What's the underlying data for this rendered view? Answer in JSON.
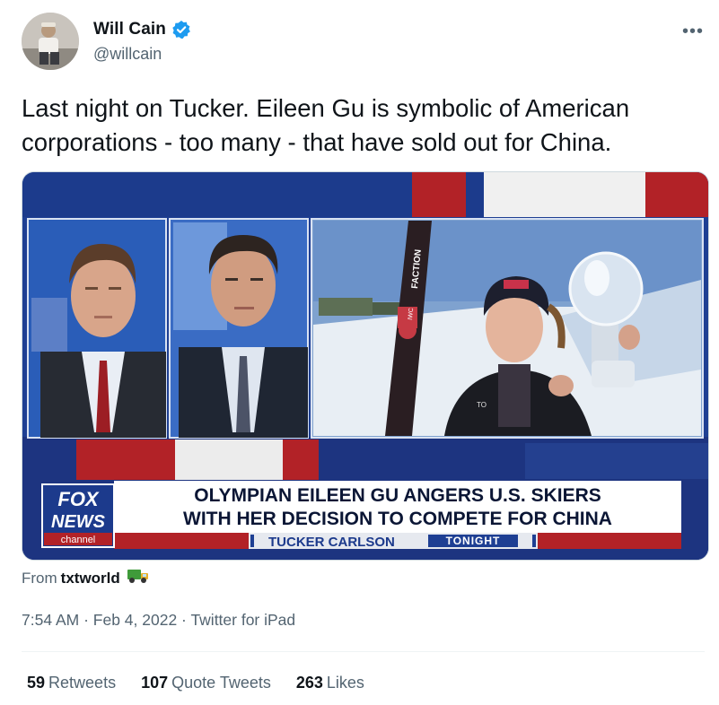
{
  "author": {
    "display_name": "Will Cain",
    "handle": "@willcain",
    "verified": true,
    "verified_color": "#1d9bf0"
  },
  "tweet": {
    "text": "Last night on Tucker. Eileen Gu is symbolic of American corporations - too many - that have sold out for China."
  },
  "media": {
    "chyron_line1": "OLYMPIAN EILEEN GU ANGERS U.S. SKIERS",
    "chyron_line2": "WITH HER DECISION TO COMPETE FOR CHINA",
    "show_name": "TUCKER CARLSON",
    "show_suffix": "TONIGHT",
    "logo_line1": "FOX",
    "logo_line2": "NEWS",
    "logo_line3": "channel",
    "ski_brand": "FACTION",
    "ski_brand2": "IWC",
    "jacket_text": "TO"
  },
  "source": {
    "prefix": "From",
    "name": "txtworld",
    "icon": "truck-emoji-icon"
  },
  "meta": {
    "time": "7:54 AM",
    "date": "Feb 4, 2022",
    "client": "Twitter for iPad"
  },
  "stats": {
    "retweets_count": "59",
    "retweets_label": "Retweets",
    "quotes_count": "107",
    "quotes_label": "Quote Tweets",
    "likes_count": "263",
    "likes_label": "Likes"
  }
}
